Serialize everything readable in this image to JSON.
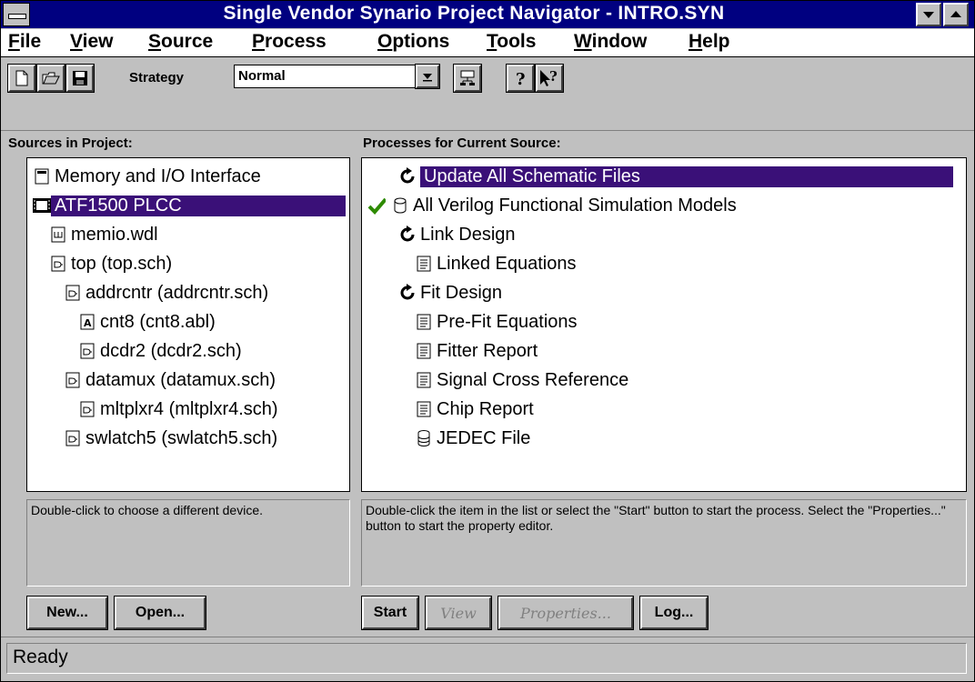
{
  "window": {
    "title": "Single Vendor Synario Project Navigator - INTRO.SYN"
  },
  "menu": {
    "items": [
      {
        "key": "F",
        "rest": "ile"
      },
      {
        "key": "V",
        "rest": "iew"
      },
      {
        "key": "S",
        "rest": "ource"
      },
      {
        "key": "P",
        "rest": "rocess"
      },
      {
        "key": "O",
        "rest": "ptions"
      },
      {
        "key": "T",
        "rest": "ools"
      },
      {
        "key": "W",
        "rest": "indow"
      },
      {
        "key": "H",
        "rest": "elp"
      }
    ]
  },
  "toolbar": {
    "strategy_label": "Strategy",
    "strategy_value": "Normal"
  },
  "sources": {
    "label": "Sources in Project:",
    "items": [
      {
        "text": "Memory and I/O Interface",
        "icon": "project-icon"
      },
      {
        "text": "ATF1500 PLCC",
        "icon": "chip-icon",
        "selected": true
      },
      {
        "text": "memio.wdl",
        "icon": "wdl-file-icon"
      },
      {
        "text": "top (top.sch)",
        "icon": "schematic-icon"
      },
      {
        "text": "addrcntr (addrcntr.sch)",
        "icon": "schematic-icon"
      },
      {
        "text": "cnt8 (cnt8.abl)",
        "icon": "abel-file-icon"
      },
      {
        "text": "dcdr2 (dcdr2.sch)",
        "icon": "schematic-icon"
      },
      {
        "text": "datamux (datamux.sch)",
        "icon": "schematic-icon"
      },
      {
        "text": "mltplxr4 (mltplxr4.sch)",
        "icon": "schematic-icon"
      },
      {
        "text": "swlatch5 (swlatch5.sch)",
        "icon": "schematic-icon"
      }
    ],
    "hint": "Double-click to choose a different device.",
    "buttons": {
      "new": "New...",
      "open": "Open..."
    }
  },
  "processes": {
    "label": "Processes for Current Source:",
    "items": [
      {
        "text": "Update All Schematic Files",
        "icon": "process-icon",
        "selected": true
      },
      {
        "text": "All Verilog Functional Simulation Models",
        "icon": "db-outline-icon",
        "done": true
      },
      {
        "text": "Link Design",
        "icon": "process-icon"
      },
      {
        "text": "Linked Equations",
        "icon": "report-icon"
      },
      {
        "text": "Fit Design",
        "icon": "process-icon"
      },
      {
        "text": "Pre-Fit Equations",
        "icon": "report-icon"
      },
      {
        "text": "Fitter Report",
        "icon": "report-icon"
      },
      {
        "text": "Signal Cross Reference",
        "icon": "report-icon"
      },
      {
        "text": "Chip Report",
        "icon": "report-icon"
      },
      {
        "text": "JEDEC File",
        "icon": "jedec-icon"
      }
    ],
    "hint": "Double-click the item in the list or select the \"Start\" button to start the process.  Select the \"Properties...\" button to start the property editor.",
    "buttons": {
      "start": "Start",
      "view": "View",
      "properties": "Properties...",
      "log": "Log..."
    }
  },
  "status": {
    "text": "Ready"
  },
  "colors": {
    "titlebar": "#000080",
    "selection": "#3a1078",
    "check": "#2e8b00"
  }
}
